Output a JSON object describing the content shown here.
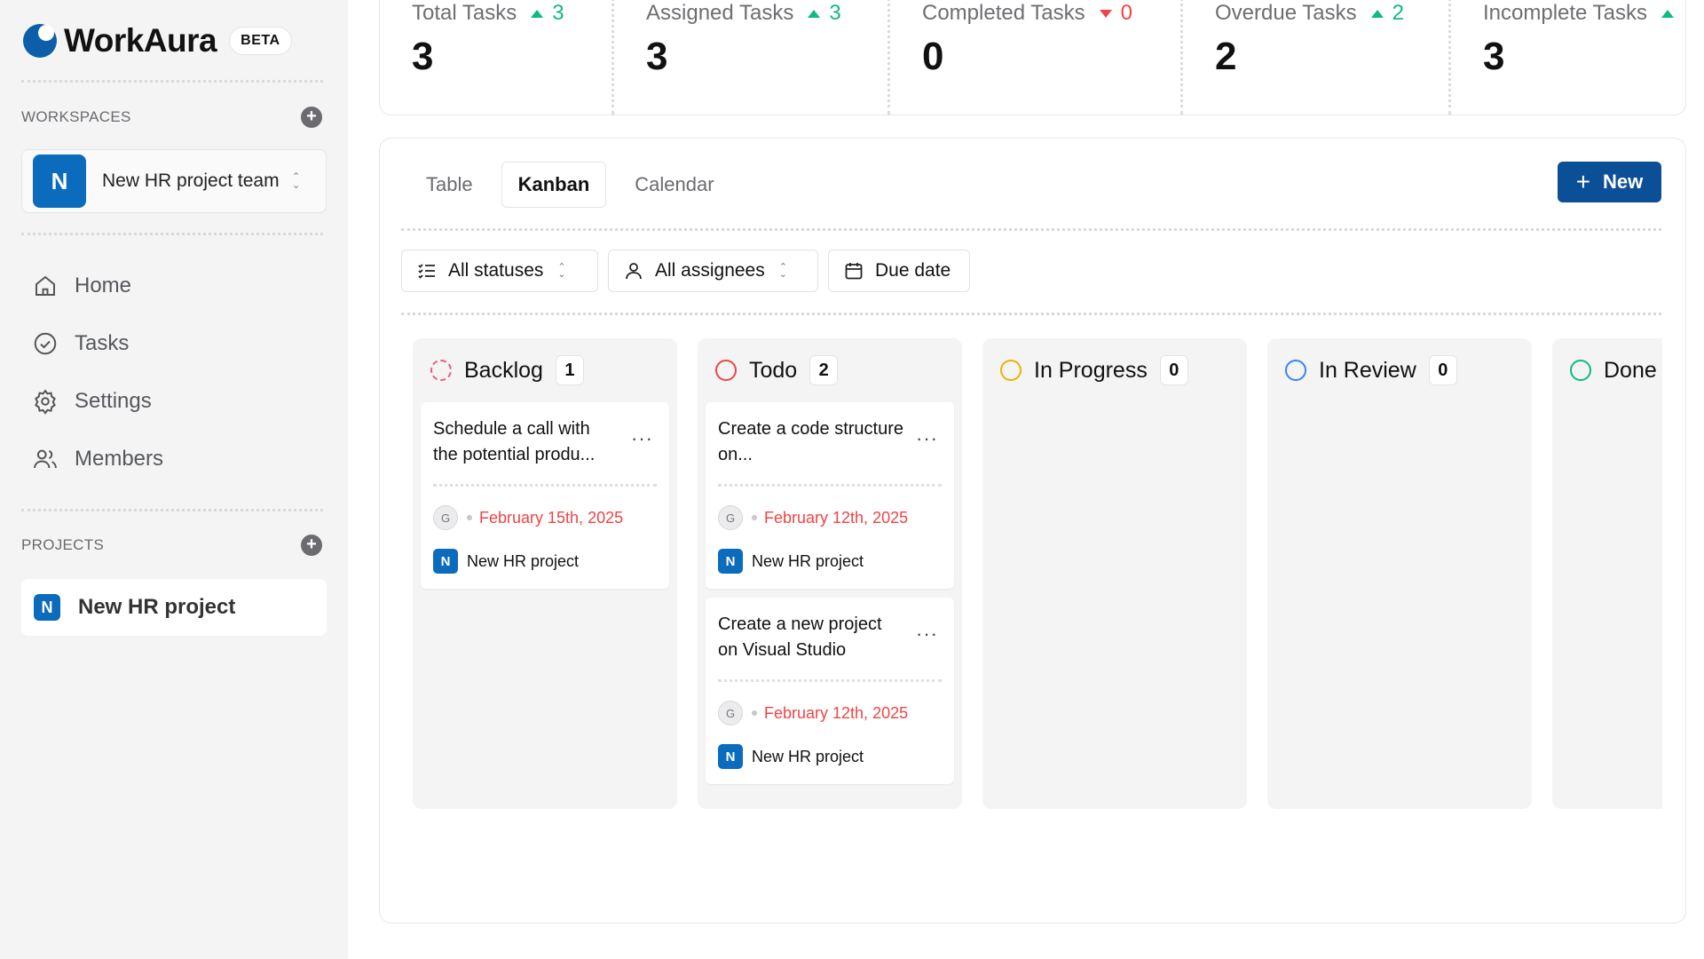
{
  "brand": {
    "name": "WorkAura",
    "badge": "BETA",
    "logo_color": "#0b5fa8"
  },
  "sidebar": {
    "workspaces_label": "WORKSPACES",
    "workspace": {
      "initial": "N",
      "name": "New HR project team"
    },
    "nav": [
      {
        "label": "Home",
        "icon": "home-icon"
      },
      {
        "label": "Tasks",
        "icon": "check-circle-icon"
      },
      {
        "label": "Settings",
        "icon": "gear-icon"
      },
      {
        "label": "Members",
        "icon": "users-icon"
      }
    ],
    "projects_label": "PROJECTS",
    "project": {
      "initial": "N",
      "name": "New HR project"
    }
  },
  "stats": [
    {
      "label": "Total Tasks",
      "delta": "3",
      "direction": "up",
      "value": "3"
    },
    {
      "label": "Assigned Tasks",
      "delta": "3",
      "direction": "up",
      "value": "3"
    },
    {
      "label": "Completed Tasks",
      "delta": "0",
      "direction": "down",
      "value": "0"
    },
    {
      "label": "Overdue Tasks",
      "delta": "2",
      "direction": "up",
      "value": "2"
    },
    {
      "label": "Incomplete Tasks",
      "delta": "",
      "direction": "up",
      "value": "3"
    }
  ],
  "view_tabs": [
    {
      "label": "Table",
      "active": false
    },
    {
      "label": "Kanban",
      "active": true
    },
    {
      "label": "Calendar",
      "active": false
    }
  ],
  "new_button": "New",
  "filters": {
    "status": "All statuses",
    "assignee": "All assignees",
    "due": "Due date"
  },
  "columns": [
    {
      "title": "Backlog",
      "count": "1",
      "color": "#ef5a7a",
      "dashed": true
    },
    {
      "title": "Todo",
      "count": "2",
      "color": "#ef4444",
      "dashed": false
    },
    {
      "title": "In Progress",
      "count": "0",
      "color": "#eab308",
      "dashed": false
    },
    {
      "title": "In Review",
      "count": "0",
      "color": "#3b82f6",
      "dashed": false
    },
    {
      "title": "Done",
      "count": "",
      "color": "#10b981",
      "dashed": false
    }
  ],
  "cards": [
    {
      "title": "Schedule a call with the potential produ...",
      "assignee": "G",
      "due": "February 15th, 2025",
      "project_initial": "N",
      "project": "New HR project"
    },
    {
      "title": "Create a code structure on...",
      "assignee": "G",
      "due": "February 12th, 2025",
      "project_initial": "N",
      "project": "New HR project"
    },
    {
      "title": "Create a new project on Visual Studio",
      "assignee": "G",
      "due": "February 12th, 2025",
      "project_initial": "N",
      "project": "New HR project"
    }
  ],
  "card_menu": "···"
}
